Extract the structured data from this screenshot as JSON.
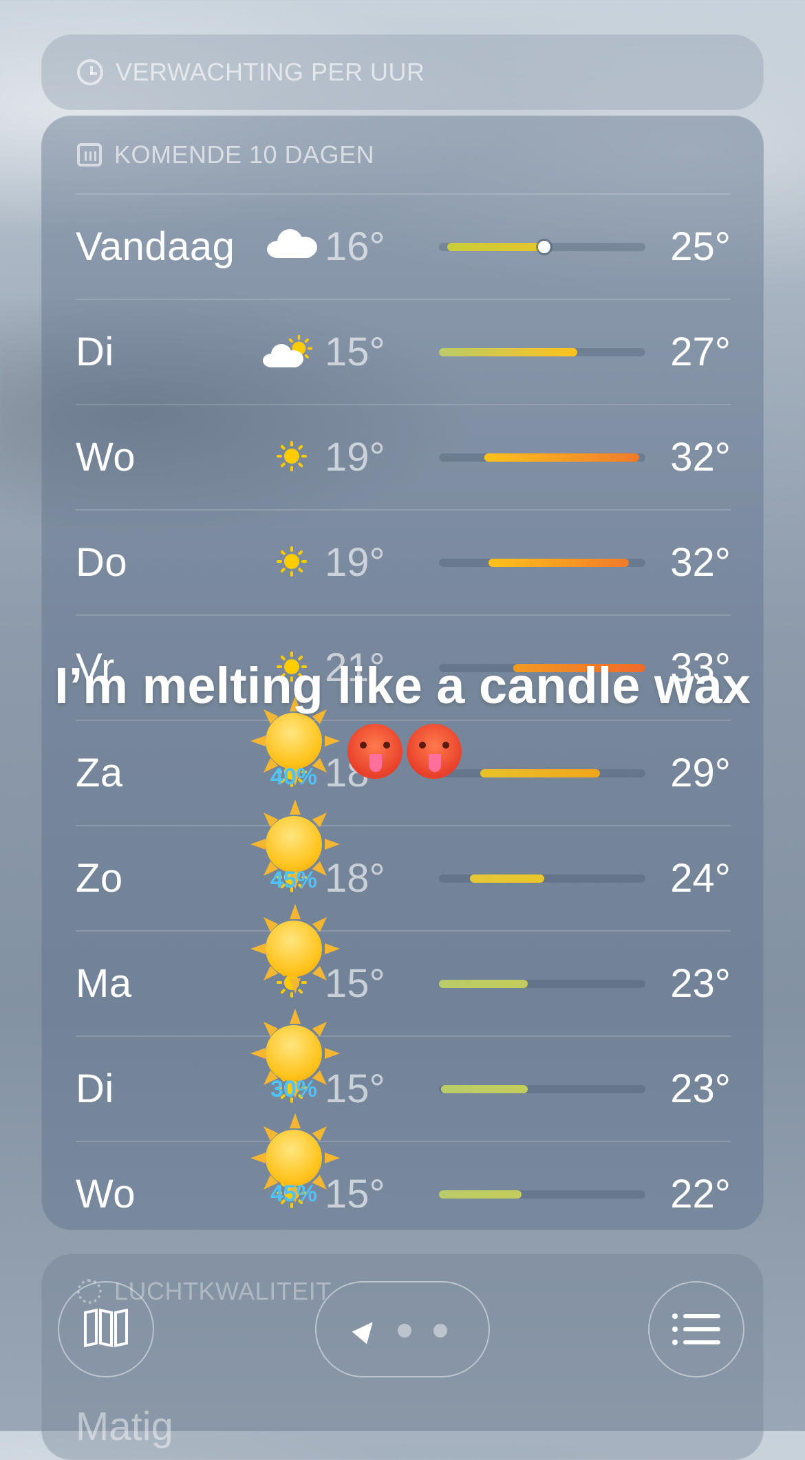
{
  "hourly": {
    "header": "VERWACHTING PER UUR",
    "icon": "clock-icon"
  },
  "daily": {
    "header": "KOMENDE 10 DAGEN",
    "icon": "calendar-icon",
    "days": [
      {
        "day": "Vandaag",
        "icon": "cloud-icon",
        "lo": "16°",
        "hi": "25°",
        "range_start": 0.04,
        "range_end": 0.51,
        "current": 0.51,
        "colors": [
          "#c8cc3c",
          "#e6c52a"
        ]
      },
      {
        "day": "Di",
        "icon": "partly-sunny-icon",
        "lo": "15°",
        "hi": "27°",
        "range_start": 0.0,
        "range_end": 0.67,
        "colors": [
          "#b9cc6a",
          "#ffc21a"
        ]
      },
      {
        "day": "Wo",
        "icon": "sun-icon",
        "lo": "19°",
        "hi": "32°",
        "range_start": 0.22,
        "range_end": 0.97,
        "colors": [
          "#ffc21a",
          "#f07a2a"
        ]
      },
      {
        "day": "Do",
        "icon": "sun-icon",
        "lo": "19°",
        "hi": "32°",
        "range_start": 0.24,
        "range_end": 0.92,
        "colors": [
          "#ffc21a",
          "#f07a2a"
        ]
      },
      {
        "day": "Vr",
        "icon": "sun-icon",
        "lo": "21°",
        "hi": "33°",
        "range_start": 0.36,
        "range_end": 1.0,
        "colors": [
          "#f39a22",
          "#f06a2a"
        ]
      },
      {
        "day": "Za",
        "icon": "sun-icon",
        "lo": "18°",
        "hi": "29°",
        "range_start": 0.2,
        "range_end": 0.78,
        "colors": [
          "#e8c22a",
          "#f3a51a"
        ]
      },
      {
        "day": "Zo",
        "icon": "sun-icon",
        "lo": "18°",
        "hi": "24°",
        "range_start": 0.15,
        "range_end": 0.51,
        "colors": [
          "#e3c83a",
          "#ebc52a"
        ]
      },
      {
        "day": "Ma",
        "icon": "sun-icon",
        "lo": "15°",
        "hi": "23°",
        "range_start": 0.0,
        "range_end": 0.43,
        "colors": [
          "#b9cc6a",
          "#c3cc5a"
        ]
      },
      {
        "day": "Di",
        "icon": "sun-icon",
        "lo": "15°",
        "hi": "23°",
        "range_start": 0.01,
        "range_end": 0.43,
        "colors": [
          "#b9cc6a",
          "#c3cc5a"
        ]
      },
      {
        "day": "Wo",
        "icon": "sun-icon",
        "lo": "15°",
        "hi": "22°",
        "range_start": 0.0,
        "range_end": 0.4,
        "colors": [
          "#b9cc6a",
          "#c3cc5a"
        ]
      }
    ]
  },
  "overlay": {
    "text": "I’m melting like a candle wax",
    "emoji": "hot-face-emoji"
  },
  "stickers": [
    {
      "percent": "40%"
    },
    {
      "percent": "45%"
    },
    {
      "percent": ""
    },
    {
      "percent": "30%"
    },
    {
      "percent": "45%"
    }
  ],
  "air_quality": {
    "header": "LUCHTKWALITEIT",
    "value": "Matig",
    "icon": "air-quality-icon"
  },
  "toolbar": {
    "map_icon": "map-icon",
    "list_icon": "list-icon",
    "location_icon": "location-arrow-icon",
    "page_count": 3
  }
}
